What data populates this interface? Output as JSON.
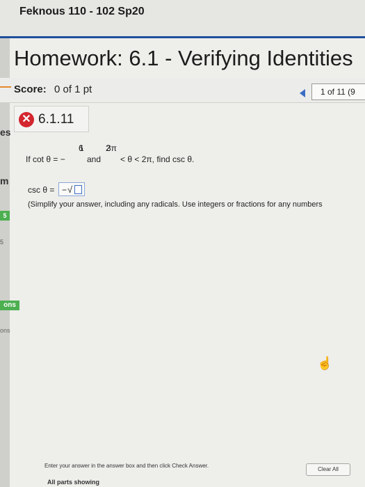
{
  "header": {
    "course_title": "Feknous 110 - 102 Sp20"
  },
  "assignment": {
    "title": "Homework: 6.1 - Verifying Identities"
  },
  "score": {
    "label": "Score:",
    "value": "0 of 1 pt"
  },
  "pager": {
    "text": "1 of 11 (9"
  },
  "question": {
    "number": "6.1.11",
    "status_icon": "x-circle-icon",
    "prompt_prefix": "If cot θ = −",
    "frac1_num": "1",
    "frac1_den": "6",
    "and": "and",
    "frac2_num": "3π",
    "frac2_den": "2",
    "prompt_suffix": "< θ < 2π, find csc θ."
  },
  "answer": {
    "label": "csc θ =",
    "prefix": "−",
    "radical": "√"
  },
  "hint": "(Simplify your answer, including any radicals. Use integers or fractions for any numbers",
  "footer": {
    "instruction": "Enter your answer in the answer box and then click Check Answer.",
    "clear_all": "Clear All",
    "parts": "All parts showing"
  },
  "sidebar": {
    "frag1": "es",
    "frag2": "m",
    "frag3": "5",
    "frag4": "5",
    "frag5": "ons",
    "frag6": "ons"
  },
  "colors": {
    "accent": "#1f4f9b",
    "error": "#d3262e",
    "link": "#3b6cc4"
  }
}
